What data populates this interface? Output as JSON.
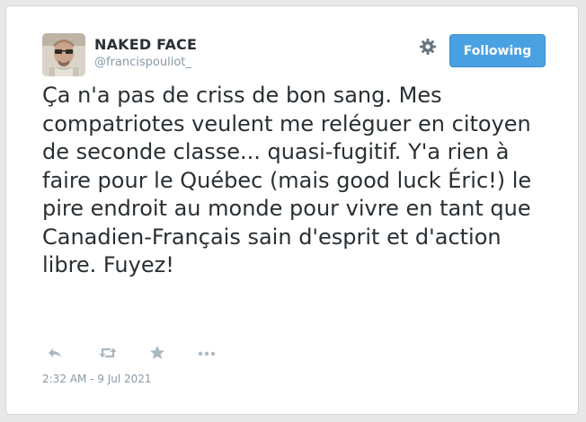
{
  "user": {
    "display_name": "NAKED FACE",
    "handle": "@francispouliot_"
  },
  "header": {
    "follow_label": "Following",
    "settings_icon": "gear-icon"
  },
  "tweet": {
    "text": "Ça n'a pas de criss de bon sang. Mes compatriotes veulent me reléguer en citoyen de seconde classe... quasi-fugitif. Y'a rien à faire pour le Québec (mais good luck Éric!) le pire endroit au monde pour vivre en tant que Canadien-Français sain d'esprit et d'action libre. Fuyez!",
    "timestamp": "2:32 AM - 9 Jul 2021"
  },
  "actions": {
    "icons": [
      "reply-icon",
      "retweet-icon",
      "favorite-icon",
      "more-icon"
    ]
  },
  "colors": {
    "accent": "#4aa1e2",
    "text": "#292f33",
    "muted": "#8899a6",
    "icon": "#aab8c2"
  }
}
